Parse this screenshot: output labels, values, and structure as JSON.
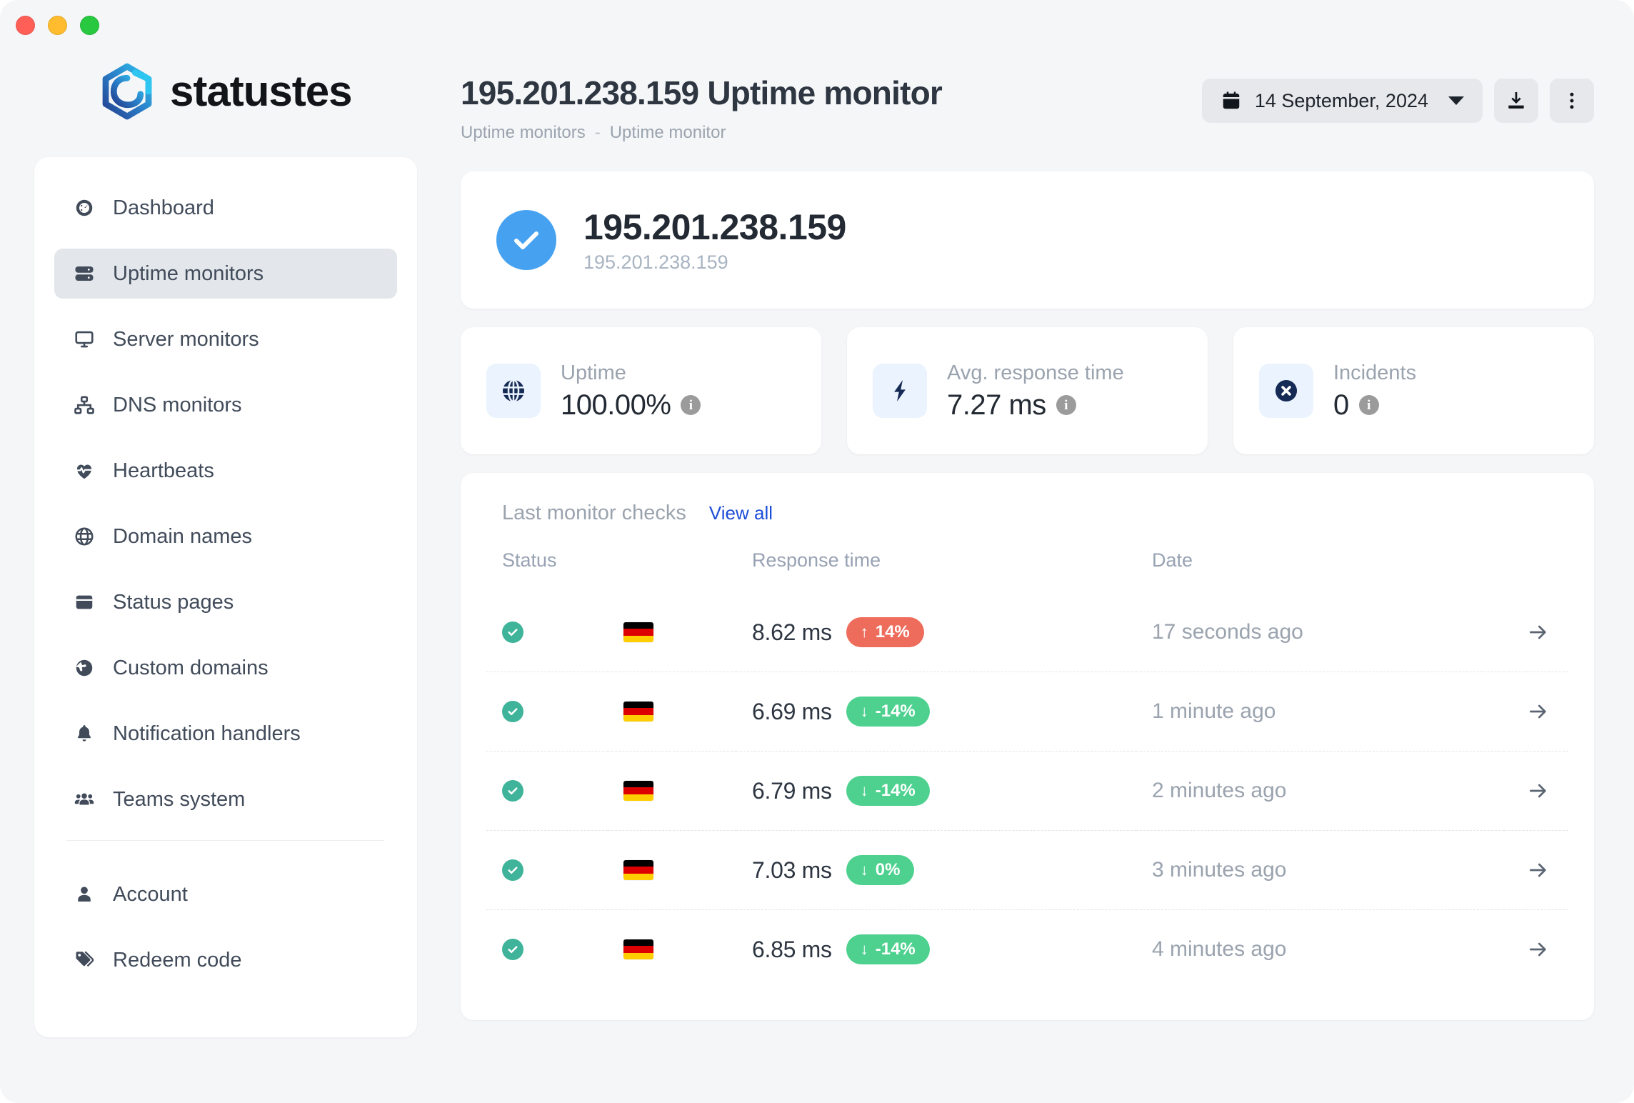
{
  "window": {
    "traffic_lights": [
      {
        "name": "close",
        "color": "#ff5f57"
      },
      {
        "name": "minimize",
        "color": "#febc2e"
      },
      {
        "name": "maximize",
        "color": "#28c840"
      }
    ]
  },
  "brand": {
    "name": "statustes",
    "logo_icon": "hexagon-spiral-logo"
  },
  "header": {
    "title": "195.201.238.159 Uptime monitor",
    "breadcrumb": {
      "parent": "Uptime monitors",
      "separator": "-",
      "current": "Uptime monitor"
    },
    "date_picker": {
      "icon": "calendar-icon",
      "value": "14 September, 2024",
      "caret": "chevron-down-icon"
    },
    "download_button": {
      "icon": "download-icon"
    },
    "more_button": {
      "icon": "kebab-menu-icon"
    }
  },
  "sidebar": {
    "items": [
      {
        "label": "Dashboard",
        "icon": "gauge-icon",
        "active": false
      },
      {
        "label": "Uptime monitors",
        "icon": "server-rack-icon",
        "active": true
      },
      {
        "label": "Server monitors",
        "icon": "desktop-icon",
        "active": false
      },
      {
        "label": "DNS monitors",
        "icon": "sitemap-icon",
        "active": false
      },
      {
        "label": "Heartbeats",
        "icon": "heart-pulse-icon",
        "active": false
      },
      {
        "label": "Domain names",
        "icon": "globe-grid-icon",
        "active": false
      },
      {
        "label": "Status pages",
        "icon": "browser-window-icon",
        "active": false
      },
      {
        "label": "Custom domains",
        "icon": "earth-globe-icon",
        "active": false
      },
      {
        "label": "Notification handlers",
        "icon": "bell-icon",
        "active": false
      },
      {
        "label": "Teams system",
        "icon": "users-group-icon",
        "active": false
      }
    ],
    "footer_items": [
      {
        "label": "Account",
        "icon": "user-icon"
      },
      {
        "label": "Redeem code",
        "icon": "tags-icon"
      }
    ]
  },
  "monitor": {
    "status_icon": "check-circle-icon",
    "status_color": "#46a2f0",
    "name": "195.201.238.159",
    "url": "195.201.238.159"
  },
  "stats": [
    {
      "label": "Uptime",
      "value": "100.00%",
      "icon": "globe-icon",
      "info_icon": "info-icon"
    },
    {
      "label": "Avg. response time",
      "value": "7.27 ms",
      "icon": "lightning-bolt-icon",
      "info_icon": "info-icon"
    },
    {
      "label": "Incidents",
      "value": "0",
      "icon": "x-circle-icon",
      "info_icon": "info-icon"
    }
  ],
  "checks": {
    "title": "Last monitor checks",
    "view_all_label": "View all",
    "columns": [
      "Status",
      "",
      "Response time",
      "Date",
      ""
    ],
    "rows": [
      {
        "status": "ok",
        "flag": "de",
        "response": "8.62 ms",
        "delta": "14%",
        "delta_direction": "up",
        "delta_arrow": "↑",
        "delta_color": "#ee6c5c",
        "date": "17 seconds ago",
        "arrow_icon": "arrow-right-icon"
      },
      {
        "status": "ok",
        "flag": "de",
        "response": "6.69 ms",
        "delta": "-14%",
        "delta_direction": "down",
        "delta_arrow": "↓",
        "delta_color": "#4ed18f",
        "date": "1 minute ago",
        "arrow_icon": "arrow-right-icon"
      },
      {
        "status": "ok",
        "flag": "de",
        "response": "6.79 ms",
        "delta": "-14%",
        "delta_direction": "down",
        "delta_arrow": "↓",
        "delta_color": "#4ed18f",
        "date": "2 minutes ago",
        "arrow_icon": "arrow-right-icon"
      },
      {
        "status": "ok",
        "flag": "de",
        "response": "7.03 ms",
        "delta": "0%",
        "delta_direction": "down",
        "delta_arrow": "↓",
        "delta_color": "#4ed18f",
        "date": "3 minutes ago",
        "arrow_icon": "arrow-right-icon"
      },
      {
        "status": "ok",
        "flag": "de",
        "response": "6.85 ms",
        "delta": "-14%",
        "delta_direction": "down",
        "delta_arrow": "↓",
        "delta_color": "#4ed18f",
        "date": "4 minutes ago",
        "arrow_icon": "arrow-right-icon"
      }
    ]
  }
}
